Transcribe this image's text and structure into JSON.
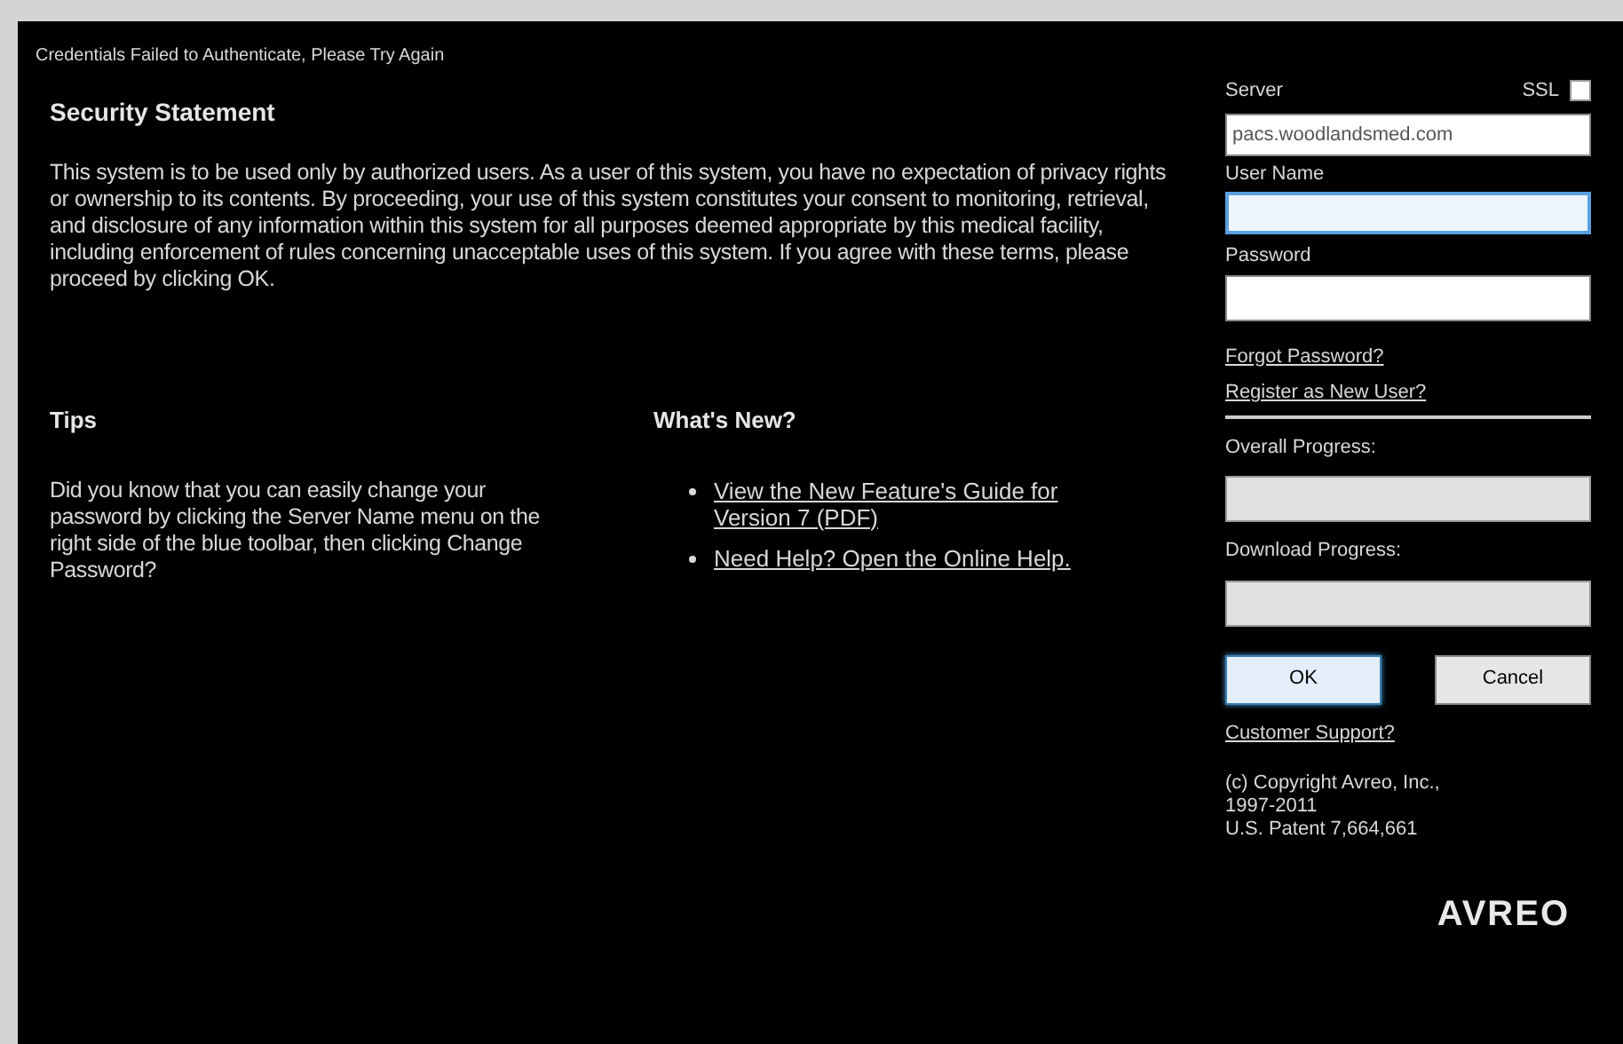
{
  "error_message": "Credentials Failed to Authenticate, Please Try Again",
  "security": {
    "heading": "Security Statement",
    "text": "This system is to be used only by authorized users. As a user of this system, you have no expectation of privacy rights or ownership to its contents. By proceeding, your use of this system constitutes your consent to monitoring, retrieval, and disclosure of any information within this system for all purposes deemed appropriate by this medical facility, including enforcement of rules concerning unacceptable uses of this system. If you agree with these terms, please proceed by clicking OK."
  },
  "tips": {
    "heading": "Tips",
    "text": "Did you know that you can easily change your password by clicking the Server Name menu on the right side of the blue toolbar, then clicking Change Password?"
  },
  "whats_new": {
    "heading": "What's New?",
    "links": [
      "View the New Feature's Guide for Version 7 (PDF)",
      "Need Help? Open the Online Help."
    ]
  },
  "login": {
    "server_label": "Server",
    "ssl_label": "SSL",
    "ssl_checked": false,
    "server_value": "pacs.woodlandsmed.com",
    "username_label": "User Name",
    "username_focused": true,
    "password_label": "Password",
    "links": [
      "Forgot Password?",
      "Register as New User?"
    ],
    "progress": [
      {
        "label": "Overall Progress:",
        "level": 0
      },
      {
        "label": "Download Progress:",
        "level": 0
      }
    ],
    "buttons": [
      {
        "label": "OK",
        "default": true
      },
      {
        "label": "Cancel",
        "default": false
      }
    ],
    "support_link": "Customer Support?",
    "copyright": [
      "(c) Copyright Avreo, Inc.,",
      "1997-2011",
      "U.S. Patent 7,664,661"
    ],
    "logo": "AVREO"
  }
}
